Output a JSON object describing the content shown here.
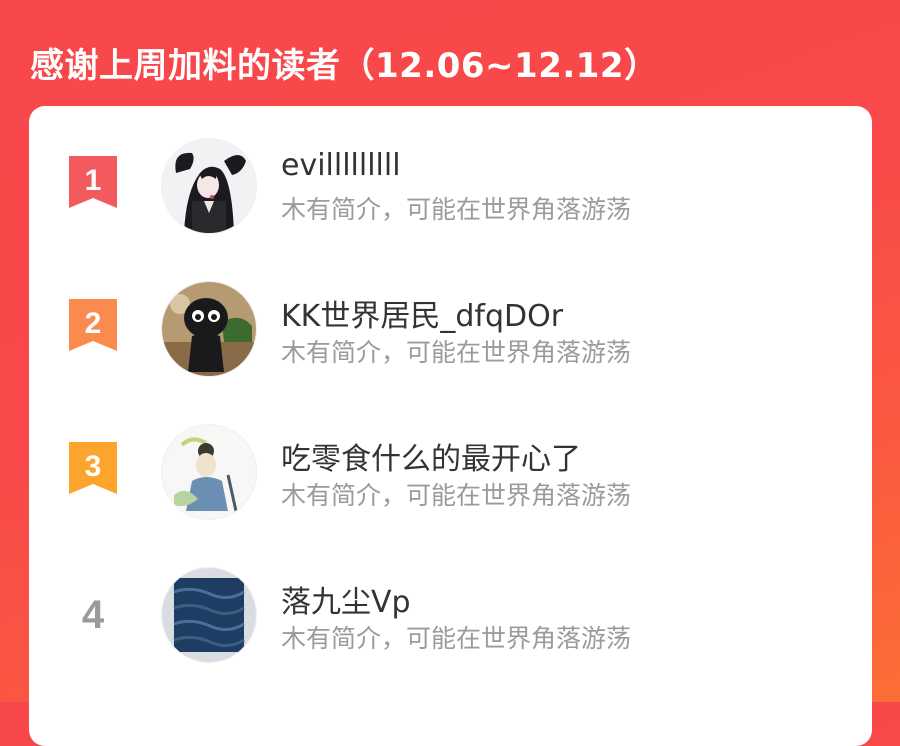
{
  "header": {
    "title": "感谢上周加料的读者（12.06~12.12）"
  },
  "readers": [
    {
      "rank": "1",
      "name": "evilllllllll",
      "intro": "木有简介，可能在世界角落游荡",
      "badge_color": "#f25a5e",
      "avatar": "anime-girl-avatar-icon"
    },
    {
      "rank": "2",
      "name": "KK世界居民_dfqDOr",
      "intro": "木有简介，可能在世界角落游荡",
      "badge_color": "#fb8a4e",
      "avatar": "panda-figure-avatar-icon"
    },
    {
      "rank": "3",
      "name": "吃零食什么的最开心了",
      "intro": "木有简介，可能在世界角落游荡",
      "badge_color": "#fca42c",
      "avatar": "ink-character-avatar-icon"
    },
    {
      "rank": "4",
      "name": "落九尘Vp",
      "intro": "木有简介，可能在世界角落游荡",
      "badge_color": "#9a9a9a",
      "avatar": "blue-sea-avatar-icon"
    }
  ]
}
